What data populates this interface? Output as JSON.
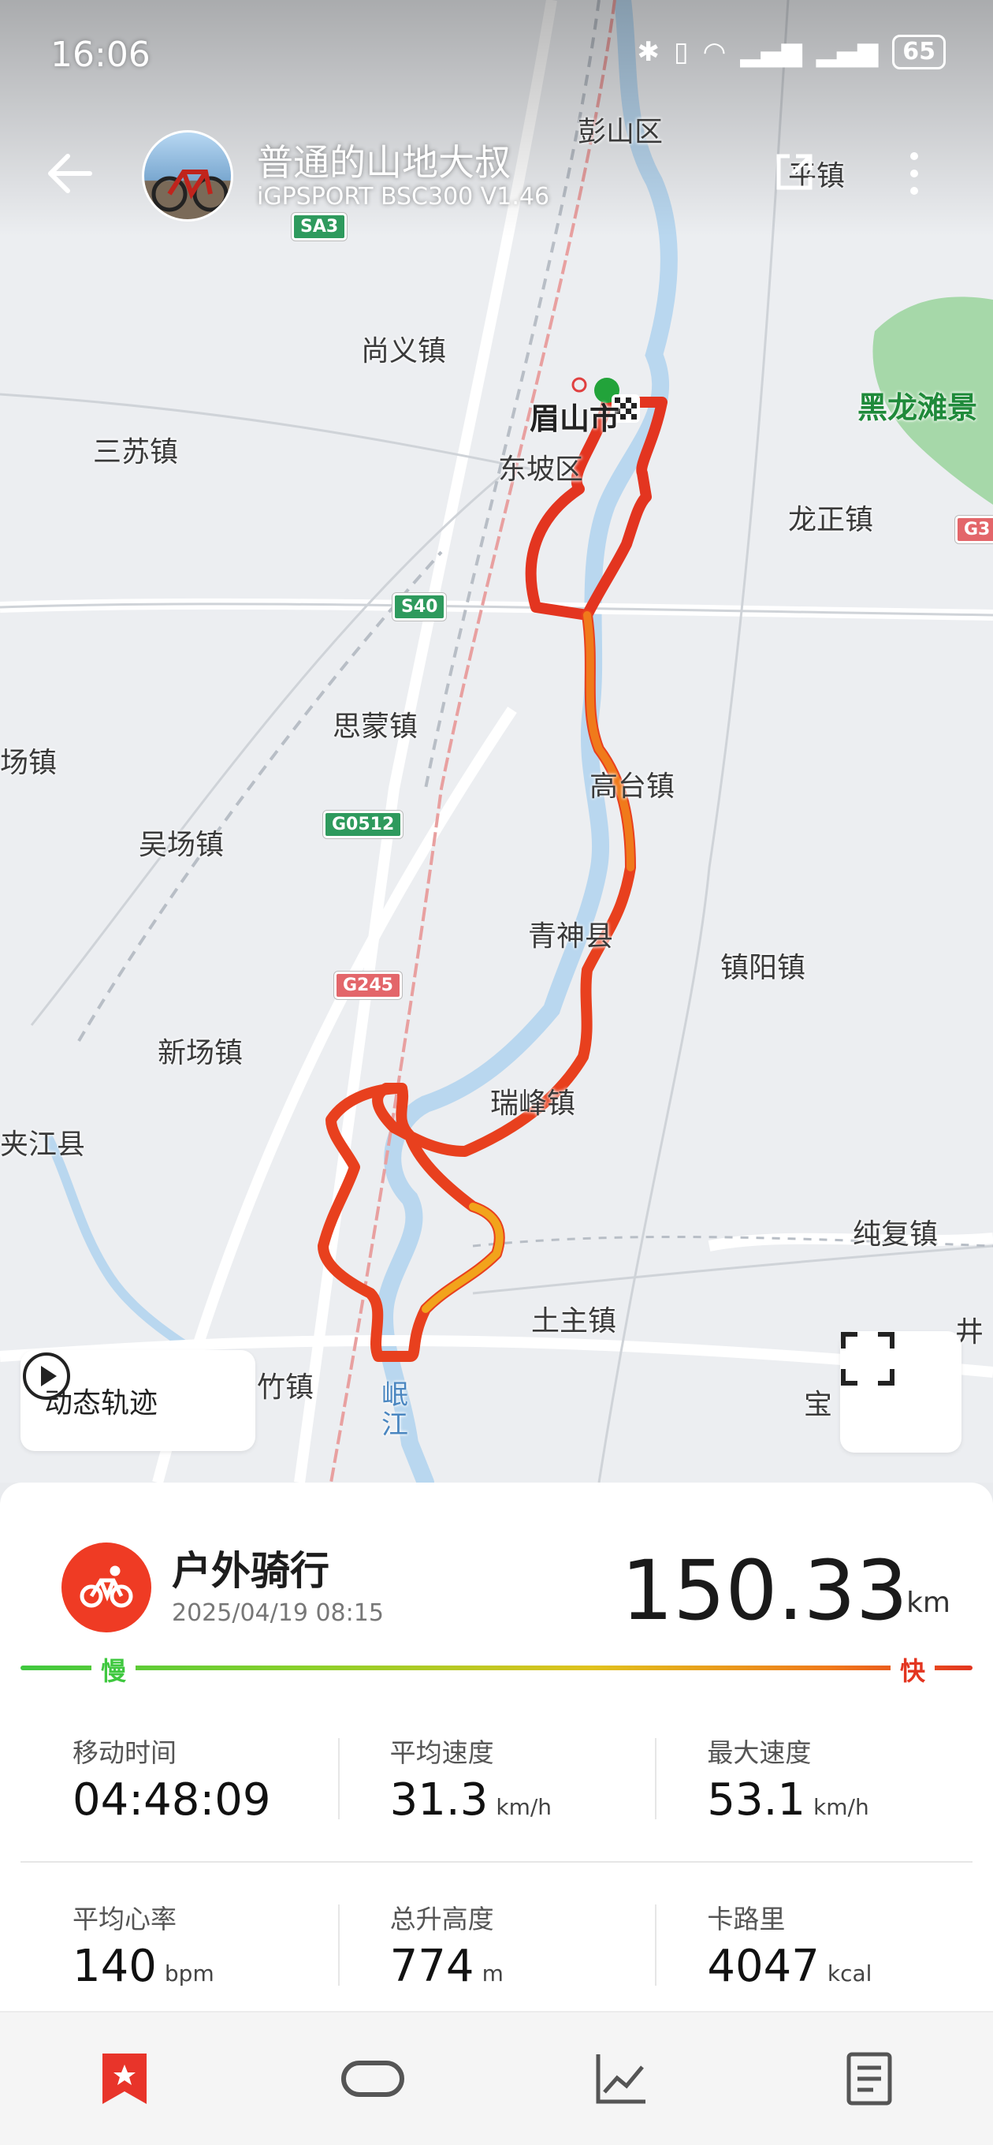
{
  "status_bar": {
    "time": "16:06",
    "battery": "65"
  },
  "header": {
    "username": "普通的山地大叔",
    "device": "iGPSPORT BSC300  V1.46"
  },
  "map": {
    "places": [
      {
        "key": "pengshan",
        "text": "彭山区"
      },
      {
        "key": "pingzhen",
        "text": "平镇"
      },
      {
        "key": "shangyi",
        "text": "尚义镇"
      },
      {
        "key": "meishan",
        "text": "眉山市"
      },
      {
        "key": "sansu",
        "text": "三苏镇"
      },
      {
        "key": "dongpo",
        "text": "东坡区"
      },
      {
        "key": "heilongtan",
        "text": "黑龙滩景"
      },
      {
        "key": "longzheng",
        "text": "龙正镇"
      },
      {
        "key": "simeng",
        "text": "思蒙镇"
      },
      {
        "key": "changzhen",
        "text": "场镇"
      },
      {
        "key": "gaotai",
        "text": "高台镇"
      },
      {
        "key": "wuchang",
        "text": "吴场镇"
      },
      {
        "key": "qingshen",
        "text": "青神县"
      },
      {
        "key": "zhenyang",
        "text": "镇阳镇"
      },
      {
        "key": "xinchang",
        "text": "新场镇"
      },
      {
        "key": "ruifeng",
        "text": "瑞峰镇"
      },
      {
        "key": "jiajiang",
        "text": "夹江县"
      },
      {
        "key": "chunfu",
        "text": "纯复镇"
      },
      {
        "key": "tuzhu",
        "text": "土主镇"
      },
      {
        "key": "mianzhu",
        "text": "竹镇"
      },
      {
        "key": "minjiang",
        "text": "岷江"
      },
      {
        "key": "bao",
        "text": "宝"
      },
      {
        "key": "jing",
        "text": "井"
      }
    ],
    "shields": [
      {
        "key": "sa3",
        "text": "SA3",
        "color": "#2e9a5d"
      },
      {
        "key": "s40",
        "text": "S40",
        "color": "#2e9a5d"
      },
      {
        "key": "g0512",
        "text": "G0512",
        "color": "#2e9a5d"
      },
      {
        "key": "g245",
        "text": "G245",
        "color": "#e3666a"
      },
      {
        "key": "g3",
        "text": "G3",
        "color": "#e3666a"
      }
    ],
    "playback_label": "动态轨迹"
  },
  "activity": {
    "type": "户外骑行",
    "datetime": "2025/04/19 08:15",
    "distance": "150.33",
    "distance_unit": "km",
    "slow_label": "慢",
    "fast_label": "快",
    "stats": [
      {
        "label": "移动时间",
        "value": "04:48:09",
        "unit": ""
      },
      {
        "label": "平均速度",
        "value": "31.3",
        "unit": "km/h"
      },
      {
        "label": "最大速度",
        "value": "53.1",
        "unit": "km/h"
      },
      {
        "label": "平均心率",
        "value": "140",
        "unit": "bpm"
      },
      {
        "label": "总升高度",
        "value": "774",
        "unit": "m"
      },
      {
        "label": "卡路里",
        "value": "4047",
        "unit": "kcal"
      }
    ]
  },
  "colors": {
    "accent": "#ef3b24",
    "route_fast": "#e33520",
    "route_mid": "#f07a1b",
    "route_slow": "#d9e21d",
    "tab_active": "#e8342a"
  },
  "tabs": [
    {
      "icon": "bookmark-star-icon",
      "active": true
    },
    {
      "icon": "lap-icon",
      "active": false
    },
    {
      "icon": "chart-icon",
      "active": false
    },
    {
      "icon": "report-icon",
      "active": false
    }
  ]
}
